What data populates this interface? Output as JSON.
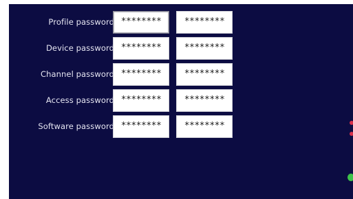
{
  "passwords": {
    "rows": [
      {
        "label": "Profile password:",
        "value1": "********",
        "value2": "********"
      },
      {
        "label": "Device password:",
        "value1": "********",
        "value2": "********"
      },
      {
        "label": "Channel password:",
        "value1": "********",
        "value2": "********"
      },
      {
        "label": "Access password:",
        "value1": "********",
        "value2": "********"
      },
      {
        "label": "Software password:",
        "value1": "********",
        "value2": "********"
      }
    ]
  },
  "colors": {
    "panel_background": "#0c0c42",
    "field_background": "#ffffff",
    "label_text": "#e6e6f2",
    "marker_red": "#d8304a",
    "marker_green": "#3fc24a"
  },
  "icons": {
    "edge_markers": [
      "red-dot-icon",
      "red-dot-icon",
      "green-dot-icon"
    ]
  }
}
